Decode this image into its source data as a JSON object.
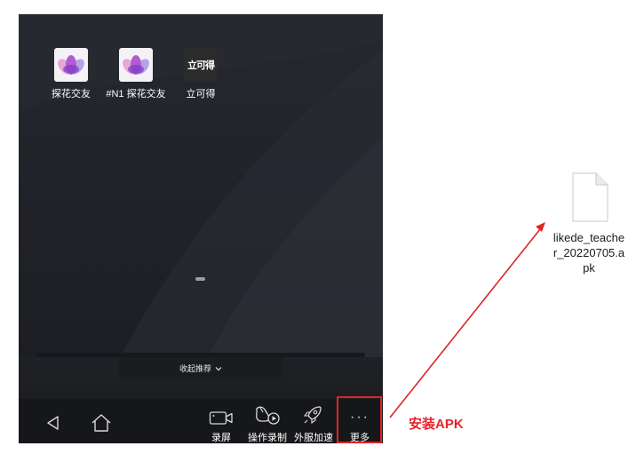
{
  "home": {
    "apps": [
      {
        "label": "探花交友",
        "icon": "lotus-icon"
      },
      {
        "label": "#N1 探花交友",
        "icon": "lotus-icon"
      },
      {
        "label": "立可得",
        "icon": "likede-logo-icon",
        "logo_text": "立可得"
      }
    ],
    "collapse_recommend": "收起推荐"
  },
  "toolbar": {
    "back_icon": "back-triangle-icon",
    "home_icon": "home-icon",
    "tools": [
      {
        "label": "录屏",
        "icon": "video-camera-icon"
      },
      {
        "label": "操作录制",
        "icon": "macro-record-icon"
      },
      {
        "label": "外服加速",
        "icon": "rocket-icon"
      },
      {
        "label": "更多",
        "icon": "more-dots-icon",
        "glyph": "···"
      }
    ]
  },
  "annotation": {
    "text": "安装APK",
    "color": "#e5252a"
  },
  "file": {
    "name": "likede_teacher_20220705.apk",
    "icon": "generic-file-icon"
  }
}
